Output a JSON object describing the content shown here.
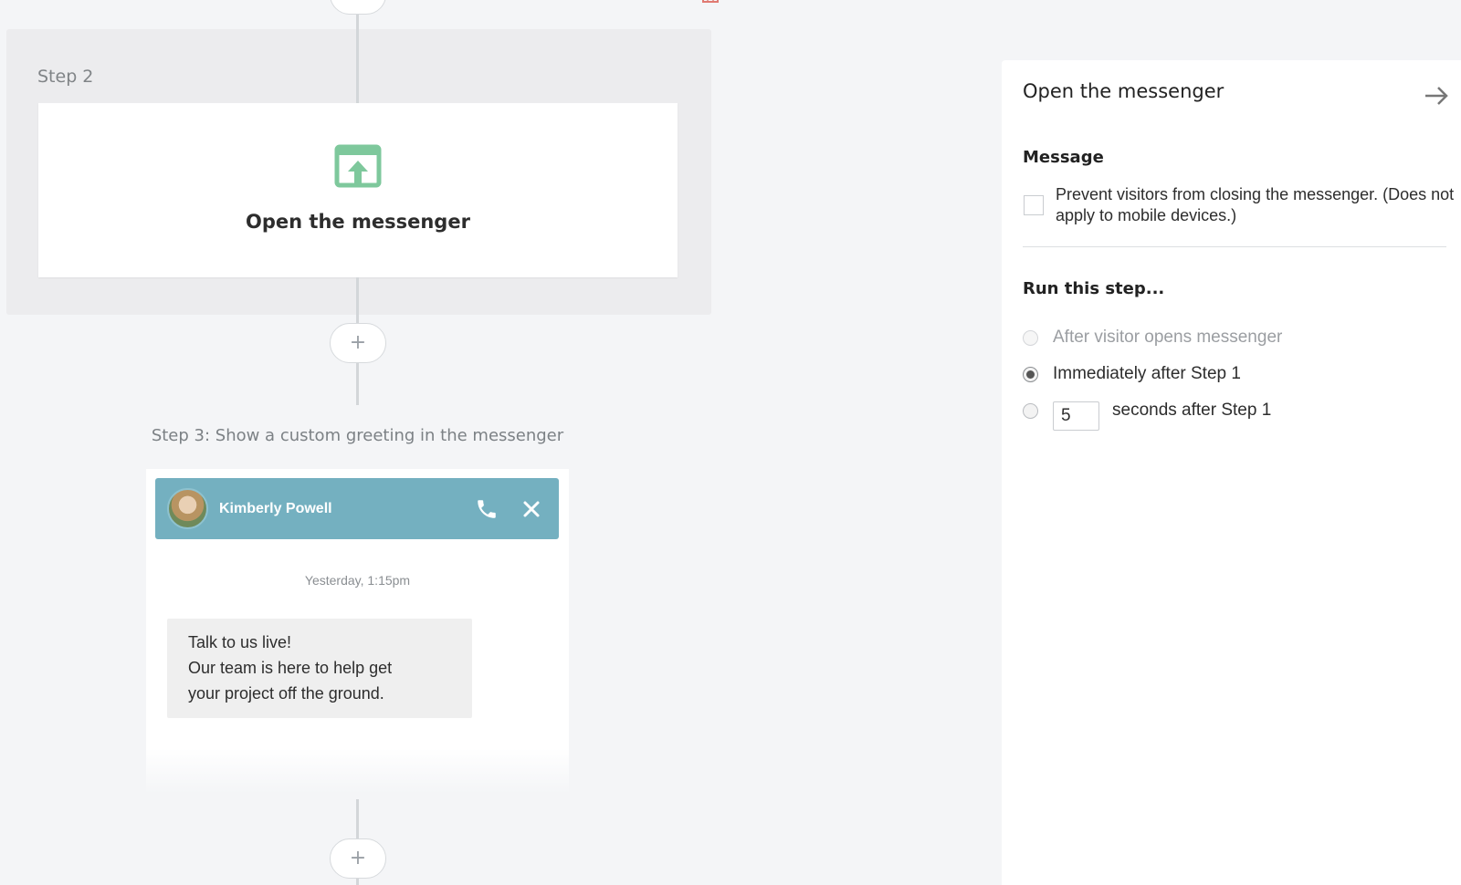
{
  "flow": {
    "add_step_symbol": "+",
    "step2": {
      "label": "Step 2",
      "card_title": "Open the messenger",
      "icon": "open-messenger-icon",
      "icon_color": "#7ec89c"
    },
    "step3": {
      "label": "Step 3: Show a custom greeting in the messenger",
      "greeting": {
        "agent_name": "Kimberly Powell",
        "header_color": "#74b0c0",
        "timestamp": "Yesterday, 1:15pm",
        "message": "Talk to us live!\nOur team is here to help get\nyour project off the ground."
      }
    }
  },
  "panel": {
    "title": "Open the messenger",
    "message_section": {
      "heading": "Message",
      "checkbox_label": "Prevent visitors from closing the messenger. (Does not apply to mobile devices.)",
      "checked": false
    },
    "run_section": {
      "heading": "Run this step...",
      "options": [
        {
          "label": "After visitor opens messenger",
          "state": "disabled"
        },
        {
          "label": "Immediately after Step 1",
          "state": "selected"
        },
        {
          "label": "seconds after Step 1",
          "state": "unselected",
          "input_value": "5"
        }
      ]
    }
  }
}
